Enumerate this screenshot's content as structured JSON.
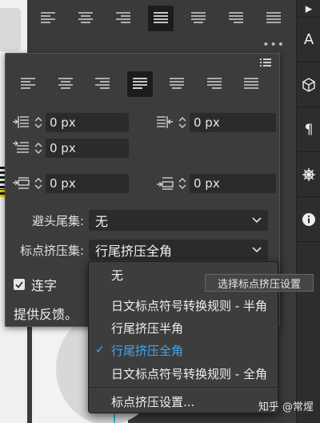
{
  "paragraph_panel": {
    "align_icons": [
      "align-left-icon",
      "align-center-icon",
      "align-right-icon",
      "justify-last-left-icon",
      "justify-last-center-icon",
      "justify-last-right-icon",
      "justify-all-icon"
    ],
    "active_align_index": 3
  },
  "indents": {
    "left_indent": "0 px",
    "right_indent": "0 px",
    "first_line_indent": "0 px",
    "space_before": "0 px",
    "space_after": "0 px"
  },
  "kinsoku": {
    "label": "避头尾集:",
    "value": "无"
  },
  "mojikumi": {
    "label": "标点挤压集:",
    "value": "行尾挤压全角"
  },
  "hyphenate": {
    "label": "连字",
    "checked": true
  },
  "feedback": "提供反馈。",
  "dropdown": {
    "options": [
      {
        "label": "无"
      },
      {
        "label": "日文标点符号转换规则 - 半角"
      },
      {
        "label": "行尾挤压半角"
      },
      {
        "label": "行尾挤压全角",
        "selected": true
      },
      {
        "label": "日文标点符号转换规则 - 全角"
      },
      {
        "label": "标点挤压设置..."
      }
    ],
    "selected_index": 3
  },
  "tooltip": "选择标点挤压设置",
  "watermark": "知乎 @常煋",
  "colors": {
    "panel_bg": "#3c3c3c",
    "field_bg": "#2b2b2b",
    "selected_accent": "#3fa6f0"
  }
}
